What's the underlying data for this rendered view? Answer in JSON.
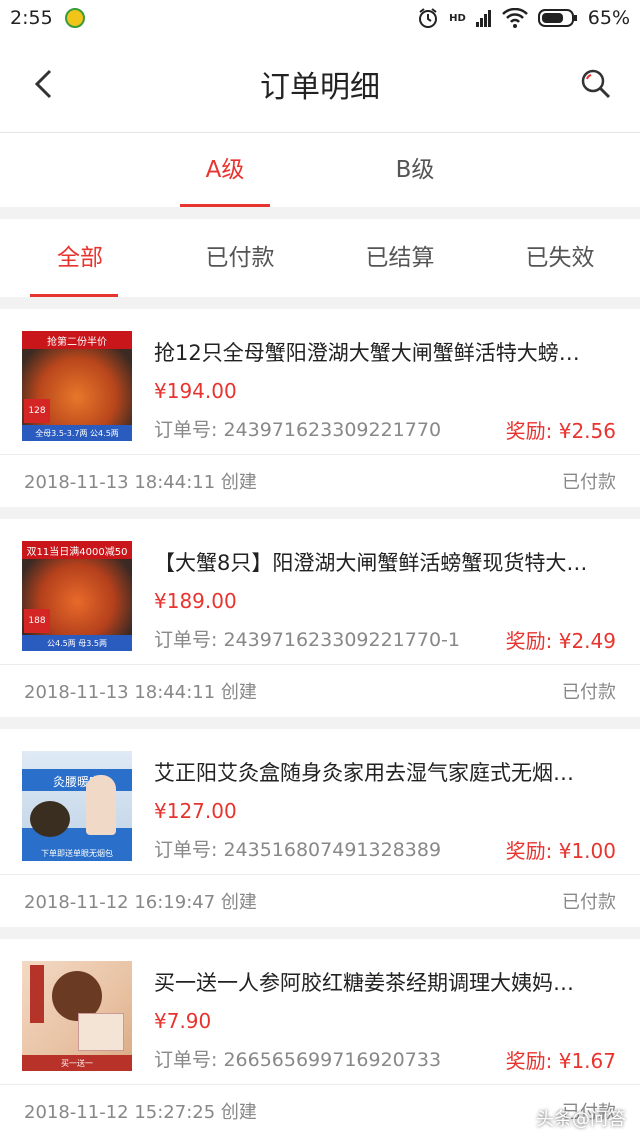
{
  "status_bar": {
    "time": "2:55",
    "network": "HD",
    "battery": "65%"
  },
  "header": {
    "title": "订单明细"
  },
  "level_tabs": [
    {
      "label": "A级",
      "active": true
    },
    {
      "label": "B级",
      "active": false
    }
  ],
  "status_tabs": [
    {
      "label": "全部",
      "active": true
    },
    {
      "label": "已付款",
      "active": false
    },
    {
      "label": "已结算",
      "active": false
    },
    {
      "label": "已失效",
      "active": false
    }
  ],
  "orders": [
    {
      "name": "抢12只全母蟹阳澄湖大蟹大闸蟹鲜活特大螃…",
      "price": "¥194.00",
      "order_no": "订单号: 243971623309221770",
      "reward": "奖励: ¥2.56",
      "created": "2018-11-13 18:44:11 创建",
      "status": "已付款",
      "thumb": {
        "caption": "抢第二份半价",
        "tag": "128",
        "caption2": "全母3.5-3.7两 公4.5两"
      }
    },
    {
      "name": "【大蟹8只】阳澄湖大闸蟹鲜活螃蟹现货特大…",
      "price": "¥189.00",
      "order_no": "订单号: 243971623309221770-1",
      "reward": "奖励: ¥2.49",
      "created": "2018-11-13 18:44:11 创建",
      "status": "已付款",
      "thumb": {
        "caption": "双11当日满4000减50",
        "tag": "188",
        "caption2": "公4.5两 母3.5两"
      }
    },
    {
      "name": "艾正阳艾灸盒随身灸家用去湿气家庭式无烟…",
      "price": "¥127.00",
      "order_no": "订单号: 243516807491328389",
      "reward": "奖励: ¥1.00",
      "created": "2018-11-12 16:19:47 创建",
      "status": "已付款",
      "thumb": {
        "caption": "灸腰暖宫",
        "tag": "",
        "caption2": "下单即送单眼无烟包"
      }
    },
    {
      "name": "买一送一人参阿胶红糖姜茶经期调理大姨妈…",
      "price": "¥7.90",
      "order_no": "订单号: 266565699716920733",
      "reward": "奖励: ¥1.67",
      "created": "2018-11-12 15:27:25 创建",
      "status": "已付款",
      "thumb": {
        "caption": "",
        "tag": "",
        "caption2": "买一送一"
      }
    }
  ],
  "watermark": "头条@问答",
  "colors": {
    "accent": "#e8342f",
    "text": "#222222",
    "muted": "#888888"
  }
}
